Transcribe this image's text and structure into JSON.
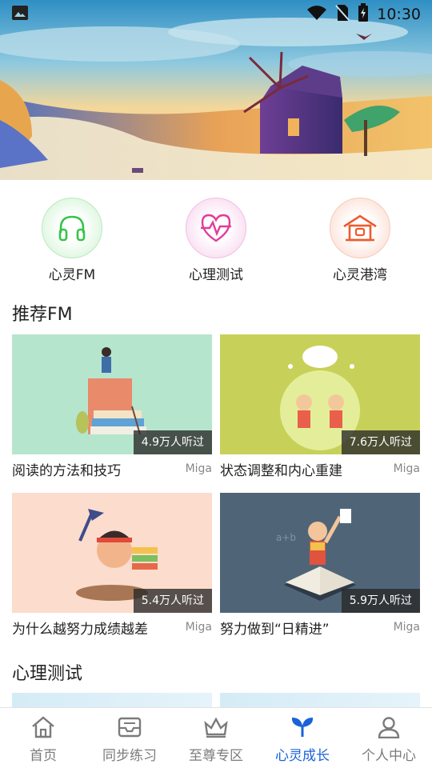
{
  "status_bar": {
    "time": "10:30",
    "icons": [
      "gallery-icon",
      "wifi-icon",
      "no-sim-icon",
      "battery-icon"
    ]
  },
  "banner": {
    "scene": "windmill-landscape-illustration"
  },
  "categories": [
    {
      "label": "心灵FM",
      "icon": "headphones-icon",
      "color": "#37c449",
      "bg": "#e3f8e3"
    },
    {
      "label": "心理测试",
      "icon": "heart-pulse-icon",
      "color": "#e33c9b",
      "bg": "#fbe3f4"
    },
    {
      "label": "心灵港湾",
      "icon": "house-icon",
      "color": "#ee5b2c",
      "bg": "#fde7df"
    }
  ],
  "recommend_fm": {
    "title": "推荐FM",
    "items": [
      {
        "title": "阅读的方法和技巧",
        "author": "Miga",
        "listeners": "4.9万人听过",
        "bg": "#b6e5cd"
      },
      {
        "title": "状态调整和内心重建",
        "author": "Miga",
        "listeners": "7.6万人听过",
        "bg": "#c7d15a"
      },
      {
        "title": "为什么越努力成绩越差",
        "author": "Miga",
        "listeners": "5.4万人听过",
        "bg": "#fbdccd"
      },
      {
        "title": "努力做到“日精进”",
        "author": "Miga",
        "listeners": "5.9万人听过",
        "bg": "#4f6577"
      }
    ]
  },
  "psych_test": {
    "title": "心理测试"
  },
  "bottom_nav": [
    {
      "label": "首页",
      "icon": "home-icon",
      "active": false
    },
    {
      "label": "同步练习",
      "icon": "inbox-icon",
      "active": false
    },
    {
      "label": "至尊专区",
      "icon": "crown-icon",
      "active": false
    },
    {
      "label": "心灵成长",
      "icon": "sprout-icon",
      "active": true
    },
    {
      "label": "个人中心",
      "icon": "person-icon",
      "active": false
    }
  ],
  "colors": {
    "accent": "#1a62d8",
    "inactive": "#7b7b7b"
  }
}
